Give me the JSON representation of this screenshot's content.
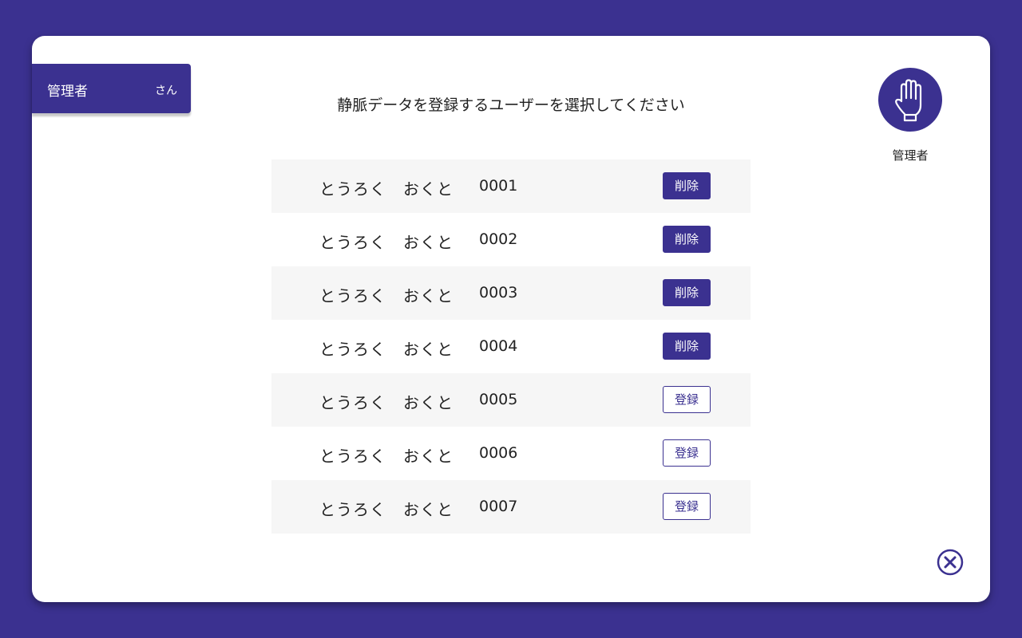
{
  "colors": {
    "accent": "#3b3190",
    "row_shade": "#f6f6f6",
    "card": "#ffffff"
  },
  "header": {
    "user_name": "管理者",
    "user_suffix": "さん",
    "title": "静脈データを登録するユーザーを選択してください"
  },
  "profile": {
    "icon": "hand-icon",
    "label": "管理者"
  },
  "users": [
    {
      "name": "とうろく　おくと",
      "id": "0001",
      "action": "削除",
      "type": "delete"
    },
    {
      "name": "とうろく　おくと",
      "id": "0002",
      "action": "削除",
      "type": "delete"
    },
    {
      "name": "とうろく　おくと",
      "id": "0003",
      "action": "削除",
      "type": "delete"
    },
    {
      "name": "とうろく　おくと",
      "id": "0004",
      "action": "削除",
      "type": "delete"
    },
    {
      "name": "とうろく　おくと",
      "id": "0005",
      "action": "登録",
      "type": "register"
    },
    {
      "name": "とうろく　おくと",
      "id": "0006",
      "action": "登録",
      "type": "register"
    },
    {
      "name": "とうろく　おくと",
      "id": "0007",
      "action": "登録",
      "type": "register"
    }
  ],
  "close_icon": "close-circle-icon"
}
